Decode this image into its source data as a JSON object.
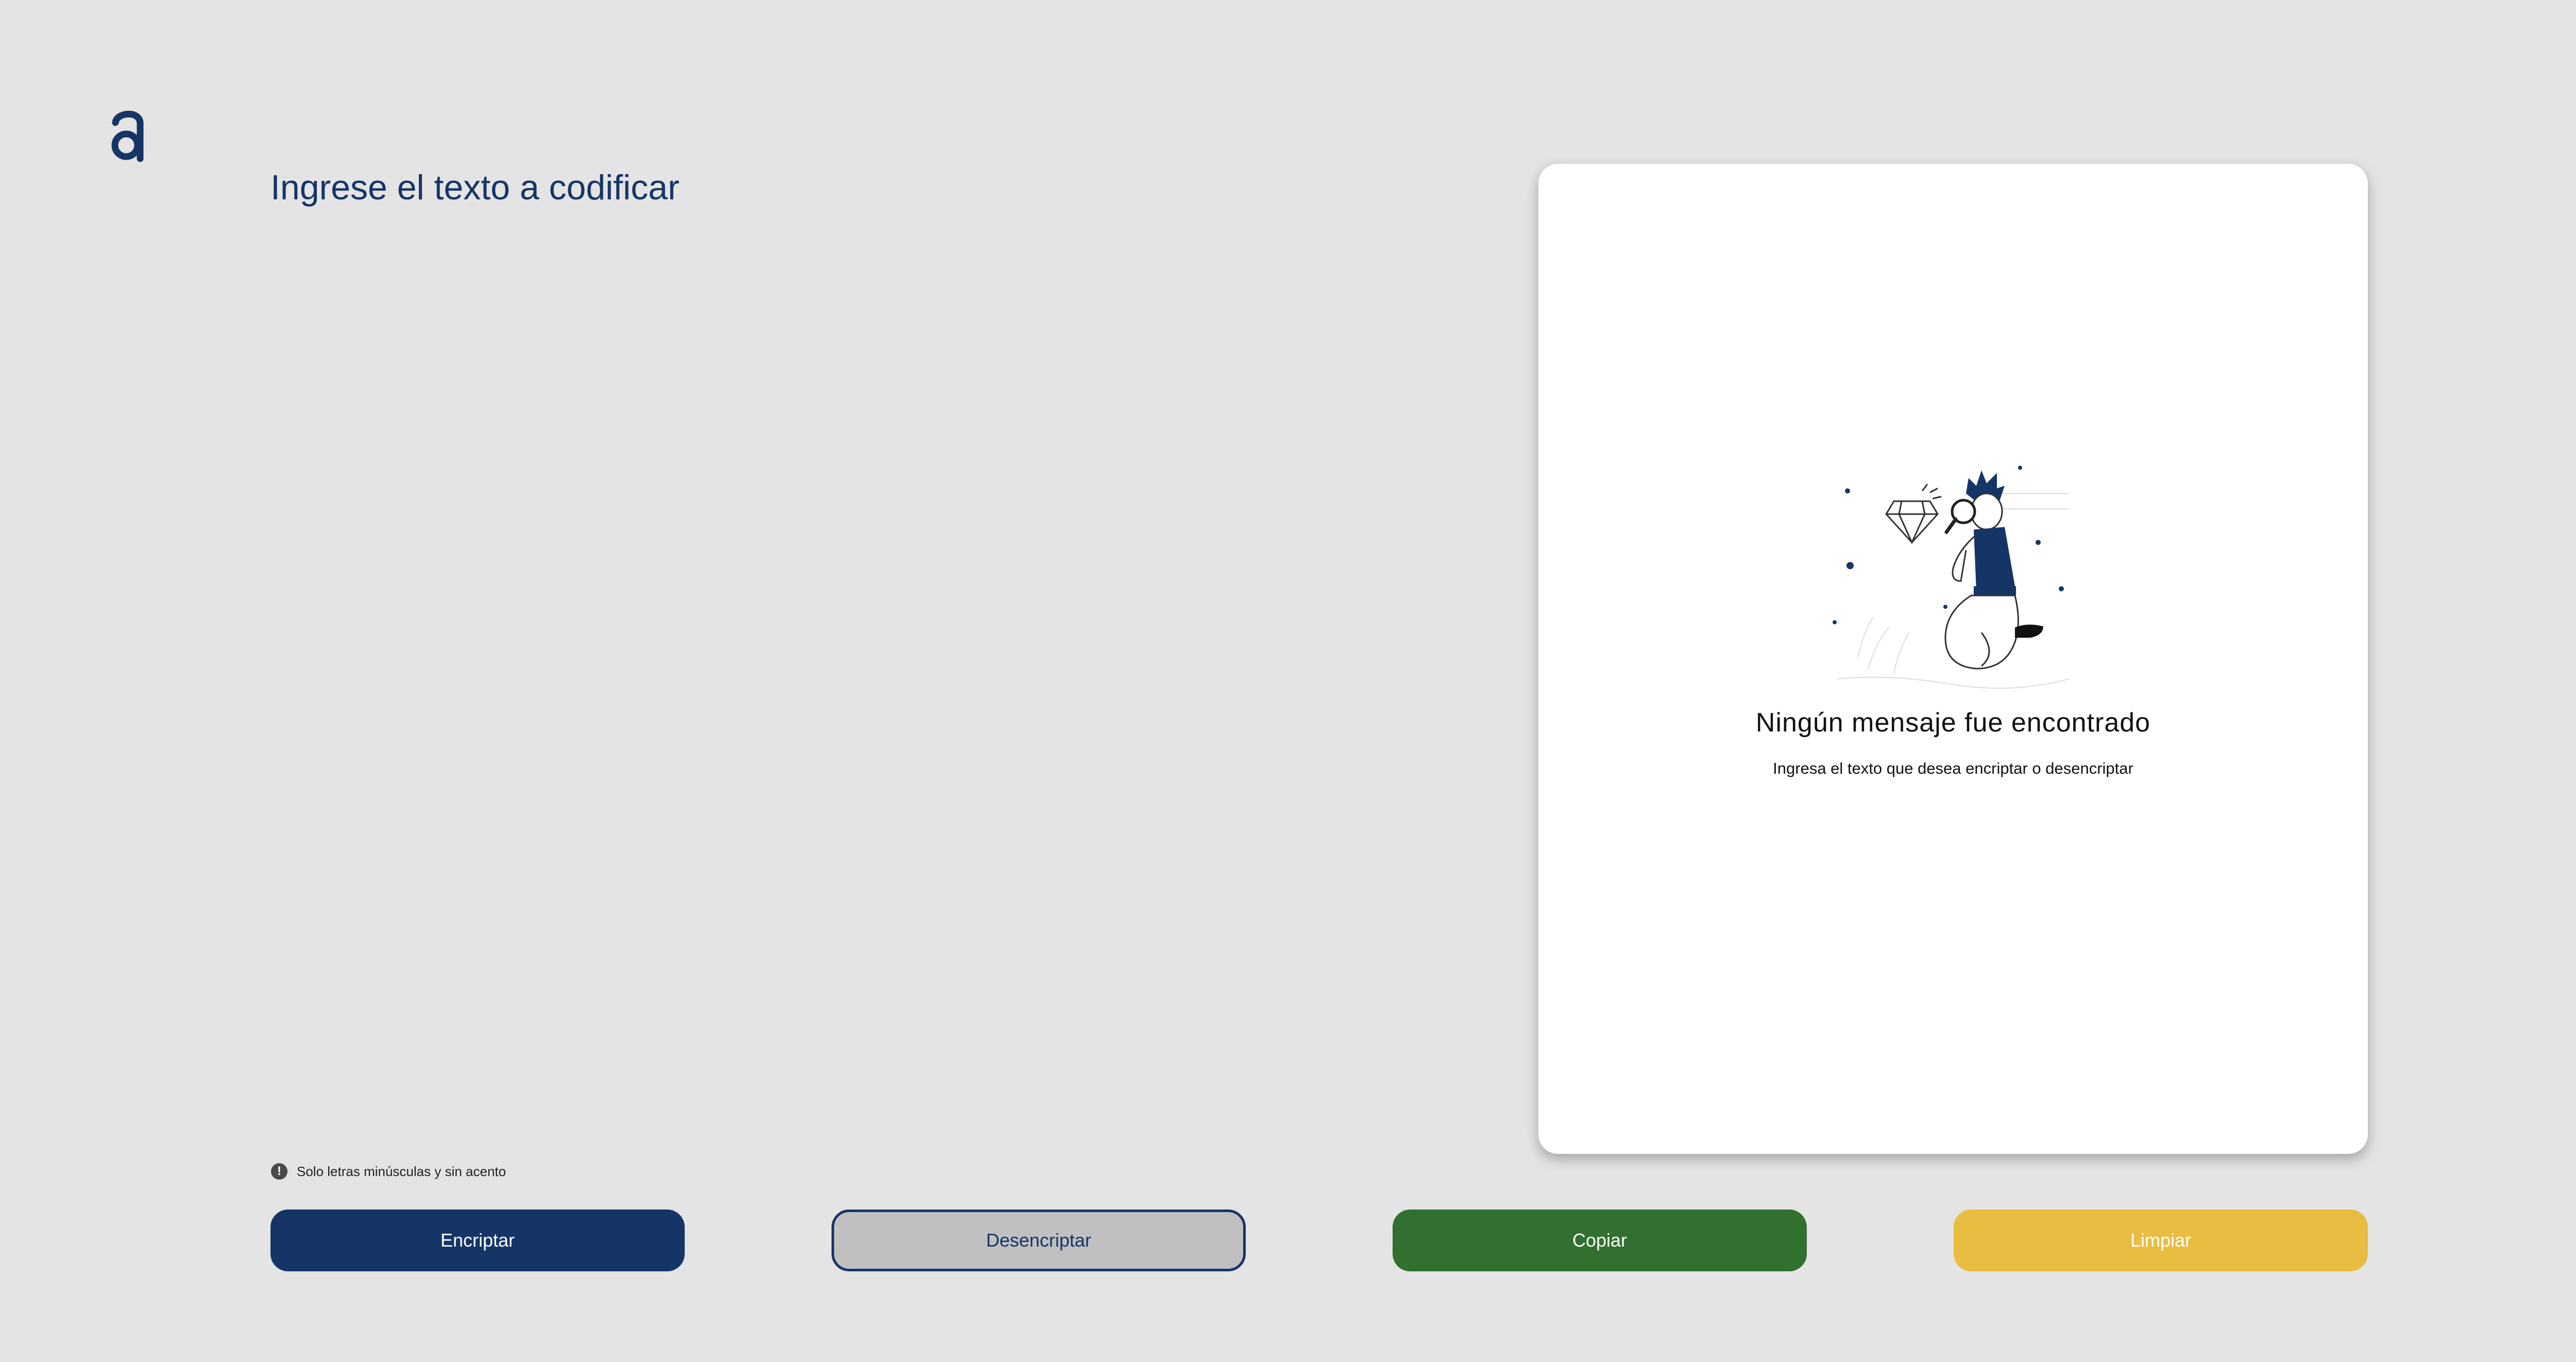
{
  "logo": {
    "letter": "a",
    "color": "#163567"
  },
  "input": {
    "placeholder": "Ingrese el texto a codificar",
    "value": ""
  },
  "output": {
    "title": "Ningún mensaje fue encontrado",
    "subtitle": "Ingresa el texto que desea encriptar o desencriptar",
    "illustration": "person-with-magnifying-glass-and-diamond"
  },
  "hint": {
    "icon": "info-icon",
    "text": "Solo letras minúsculas y sin acento"
  },
  "buttons": {
    "encrypt": "Encriptar",
    "decrypt": "Desencriptar",
    "copy": "Copiar",
    "clear": "Limpiar"
  },
  "colors": {
    "background": "#e4e4e4",
    "primary": "#163567",
    "secondary": "#c0c0c0",
    "copy": "#32702f",
    "clear": "#e8bd42",
    "card": "#ffffff"
  }
}
